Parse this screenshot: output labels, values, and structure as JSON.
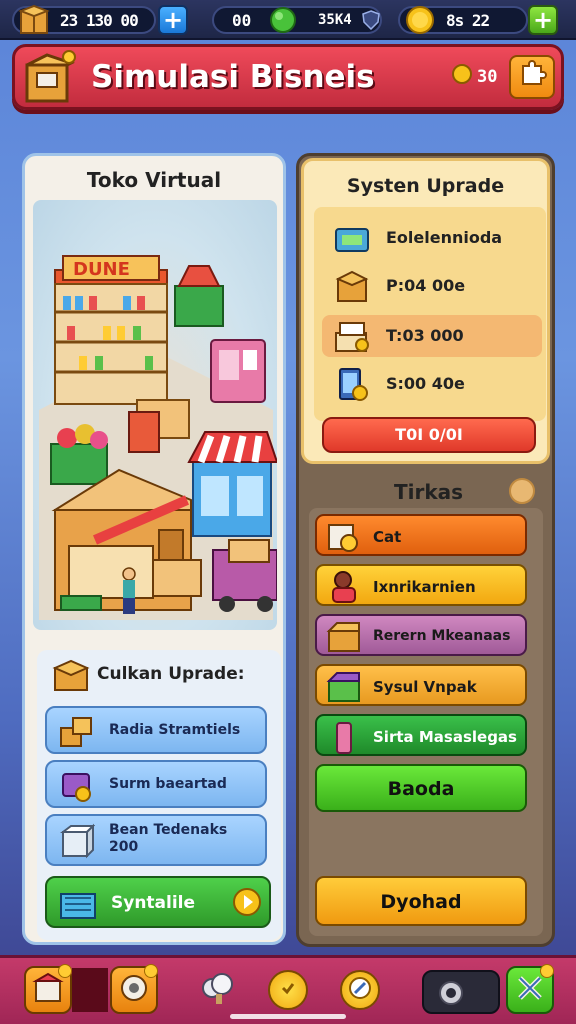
{
  "top_bar": {
    "resource1": {
      "value": "23 130 00",
      "icon": "crate-icon"
    },
    "resource2": {
      "value": "00",
      "icon": "gem-icon"
    },
    "resource3": {
      "value": "35K4",
      "icon": "shield-icon"
    },
    "resource4": {
      "value": "8s 22",
      "icon": "coin-icon"
    },
    "plus": "+"
  },
  "header": {
    "title": "Simulasi Bisneis",
    "coin_value": "30",
    "icon": "treasure-box-icon"
  },
  "left_panel": {
    "title": "Toko Virtual",
    "scene_sign": "DUNE",
    "upgrade_section": {
      "title": "Culkan Uprade:",
      "items": [
        {
          "label": "Radia Stramtiels",
          "icon": "boxes-icon"
        },
        {
          "label": "Surm baeartad",
          "icon": "gift-bag-icon"
        },
        {
          "label": "Bean Tedenaks 200",
          "icon": "cube-icon"
        }
      ],
      "action_button": "Syntalile"
    }
  },
  "right_panel": {
    "system": {
      "title": "Systen Uprade",
      "rows": [
        {
          "label": "Eolelennioda",
          "icon": "machine-icon"
        },
        {
          "label": "P:04 00e",
          "icon": "crate-icon"
        },
        {
          "label": "T:03 000",
          "icon": "stack-icon"
        },
        {
          "label": "S:00 40e",
          "icon": "tablet-icon"
        }
      ],
      "button": "T0I 0/0I"
    },
    "tasks": {
      "title": "Tirkas",
      "items": [
        {
          "label": "Cat",
          "icon": "box-search-icon",
          "color": "#f27a1e"
        },
        {
          "label": "Ixnrikarnien",
          "icon": "worker-icon",
          "color": "#f6b418"
        },
        {
          "label": "Rerern Mkeanaas",
          "icon": "chest-icon",
          "color": "#b86aa8"
        },
        {
          "label": "Sysul Vnpak",
          "icon": "package-icon",
          "color": "#f2a83a"
        },
        {
          "label": "Sirta Masaslegas",
          "icon": "bottle-icon",
          "color": "#2fa23a"
        }
      ],
      "button_green": "Baoda",
      "button_orange": "Dyohad"
    }
  },
  "bottom_bar": {
    "icons": [
      "shop-icon",
      "crate-alt-icon",
      "cloud-icon",
      "coin-alt-icon",
      "compass-icon",
      "settings-icon",
      "tools-icon"
    ]
  }
}
